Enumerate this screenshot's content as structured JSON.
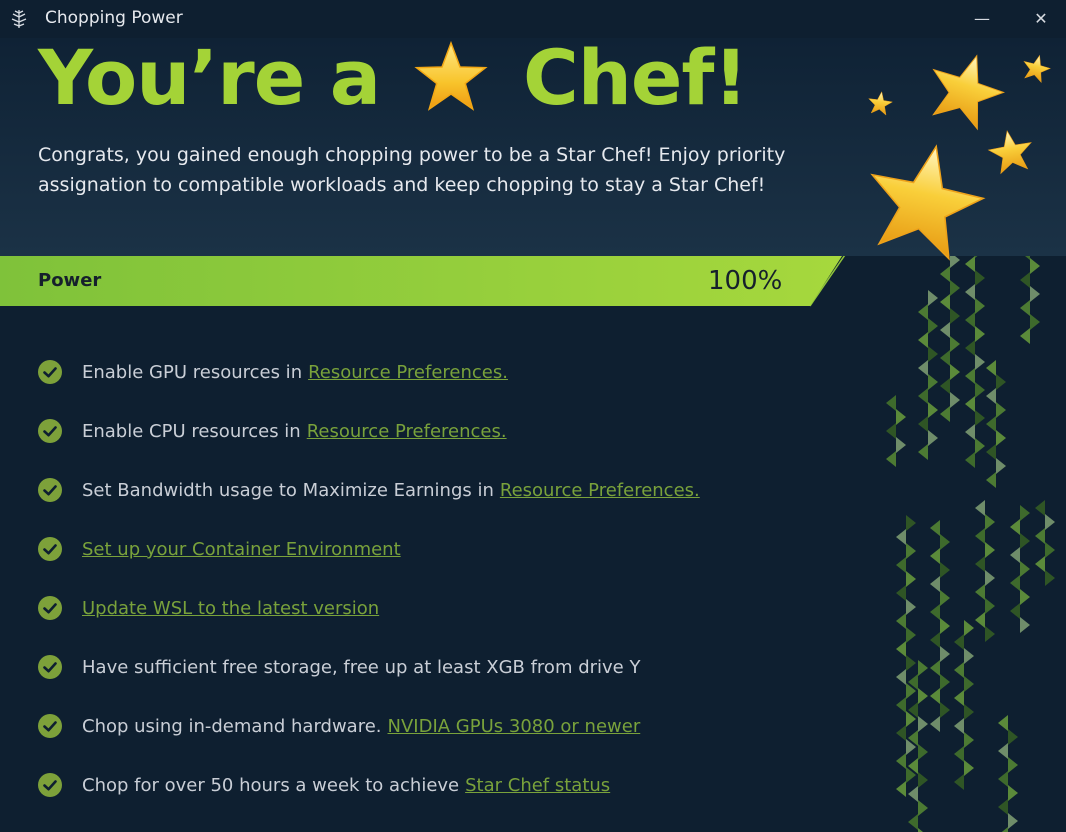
{
  "window": {
    "title": "Chopping Power",
    "icon": "chopping-power-logo-icon",
    "minimize_symbol": "—",
    "close_symbol": "✕"
  },
  "hero": {
    "title_before": "You’re a",
    "title_icon": "star-icon",
    "title_after": "Chef!",
    "description": "Congrats, you gained enough chopping power to be a Star Chef! Enjoy priority assignation to compatible workloads and keep chopping to stay a Star Chef!"
  },
  "power": {
    "label": "Power",
    "value_text": "100%",
    "fraction": 1.0
  },
  "checklist": [
    {
      "text": "Enable GPU resources in",
      "link": "Resource Preferences.",
      "done": true
    },
    {
      "text": "Enable CPU resources in",
      "link": "Resource Preferences.",
      "done": true
    },
    {
      "text": "Set Bandwidth usage to Maximize Earnings in",
      "link": "Resource Preferences.",
      "done": true
    },
    {
      "text": "",
      "link": "Set up your Container Environment",
      "done": true
    },
    {
      "text": "",
      "link": "Update WSL to the latest version",
      "done": true
    },
    {
      "text": "Have sufficient free storage, free up at least XGB from drive Y",
      "link": "",
      "done": true
    },
    {
      "text": "Chop using in-demand hardware.",
      "link": "NVIDIA GPUs 3080 or newer",
      "done": true
    },
    {
      "text": "Chop for over 50 hours a week to achieve",
      "link": "Star Chef status",
      "done": true
    }
  ],
  "colors": {
    "background": "#0e1f30",
    "accent_green": "#a4d337",
    "link_green": "#79a23b",
    "check_green": "#7da13a",
    "star_gold": "#f5c02a"
  }
}
